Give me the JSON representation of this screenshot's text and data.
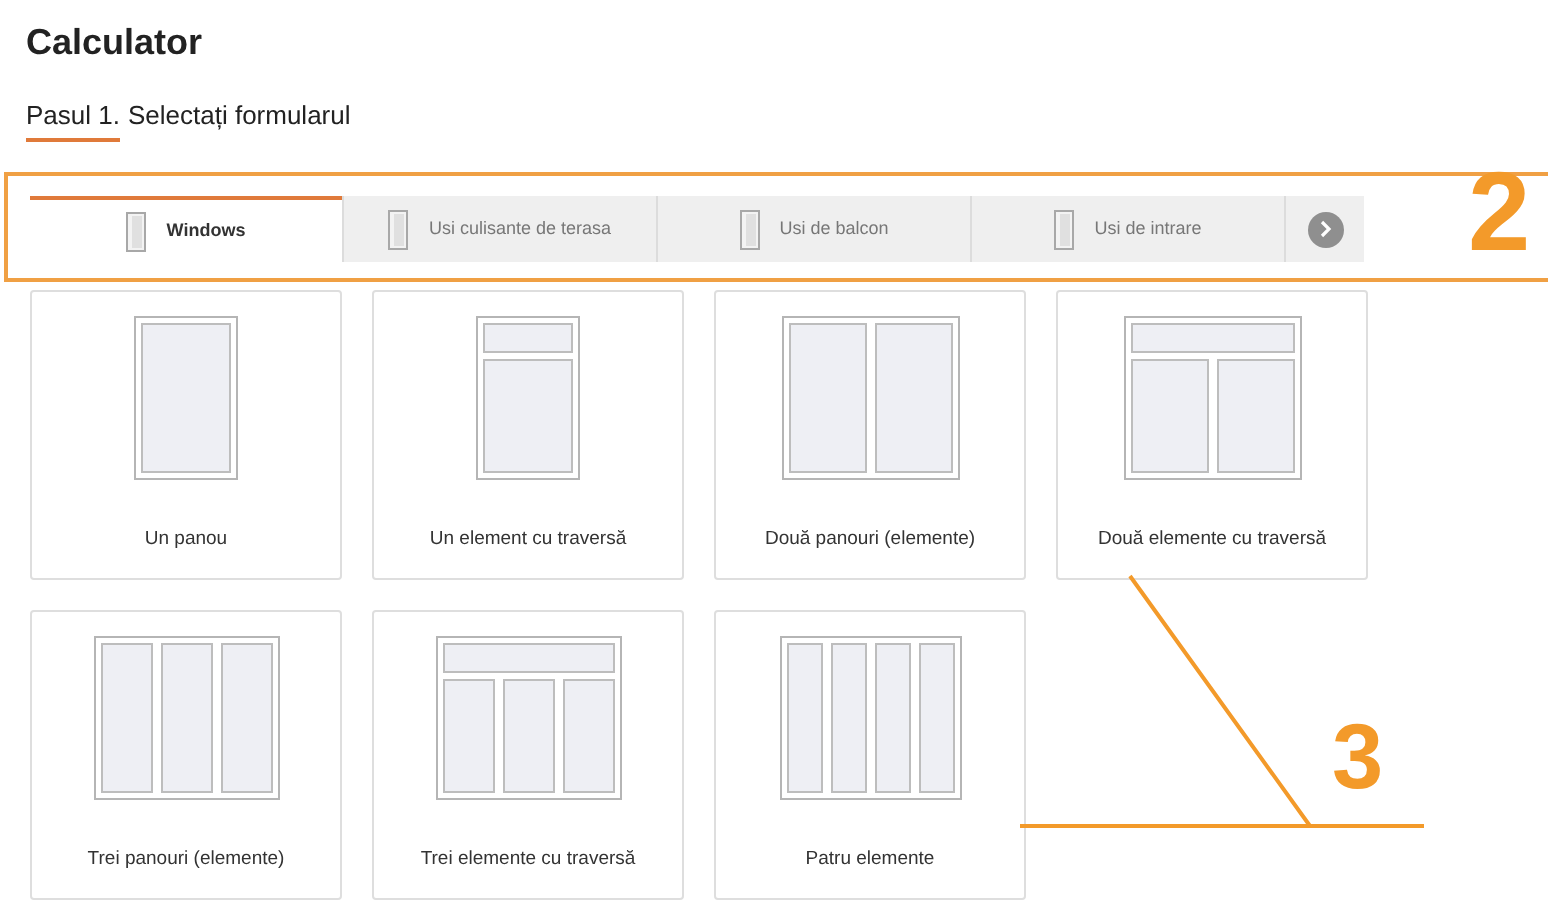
{
  "title": "Calculator",
  "step": {
    "prefix": "Pasul 1.",
    "text": "Selectați formularul"
  },
  "tabs": [
    {
      "label": "Windows",
      "selected": true
    },
    {
      "label": "Usi culisante de terasa",
      "selected": false
    },
    {
      "label": "Usi de balcon",
      "selected": false
    },
    {
      "label": "Usi de intrare",
      "selected": false
    }
  ],
  "cards": [
    {
      "label": "Un panou",
      "kind": "single"
    },
    {
      "label": "Un element cu traversă",
      "kind": "single-transom"
    },
    {
      "label": "Două panouri (elemente)",
      "kind": "double"
    },
    {
      "label": "Două elemente cu traversă",
      "kind": "double-transom"
    },
    {
      "label": "Trei panouri (elemente)",
      "kind": "triple"
    },
    {
      "label": "Trei elemente cu traversă",
      "kind": "triple-transom"
    },
    {
      "label": "Patru elemente",
      "kind": "quad"
    }
  ],
  "annotations": [
    {
      "label": "2"
    },
    {
      "label": "3"
    }
  ]
}
